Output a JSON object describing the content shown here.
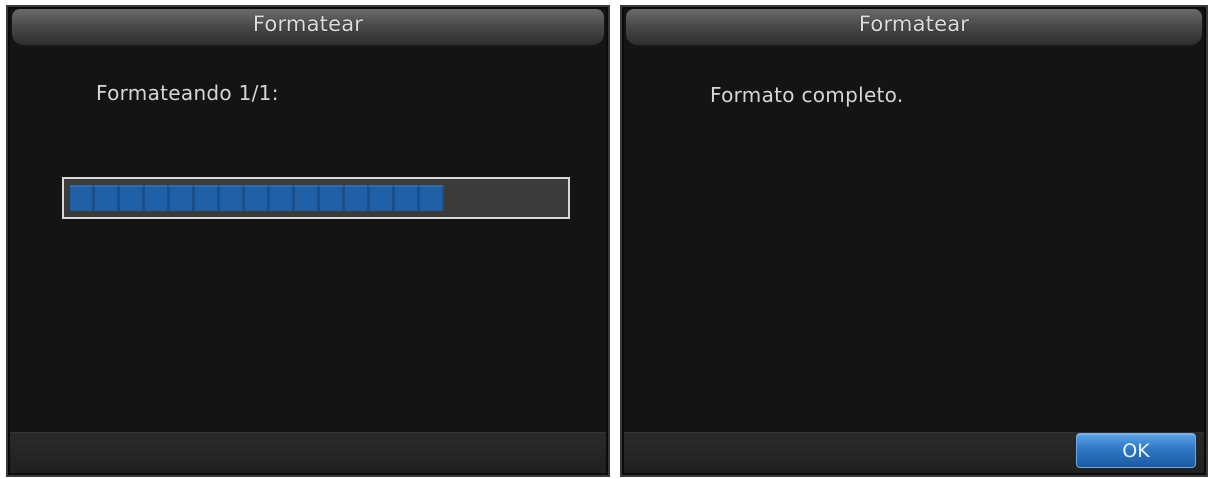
{
  "dialogs": [
    {
      "title": "Formatear",
      "message": "Formateando 1/1:",
      "progress": {
        "fraction": 0.76,
        "fill_color": "#1f5fa6"
      }
    },
    {
      "title": "Formatear",
      "message": "Formato completo.",
      "ok_label": "OK"
    }
  ],
  "colors": {
    "dialog_background": "#141414",
    "title_text": "#dcdcdc",
    "message_text": "#d6d6d6",
    "progress_border": "#d8d8d8",
    "ok_button": "#2e78c6"
  }
}
